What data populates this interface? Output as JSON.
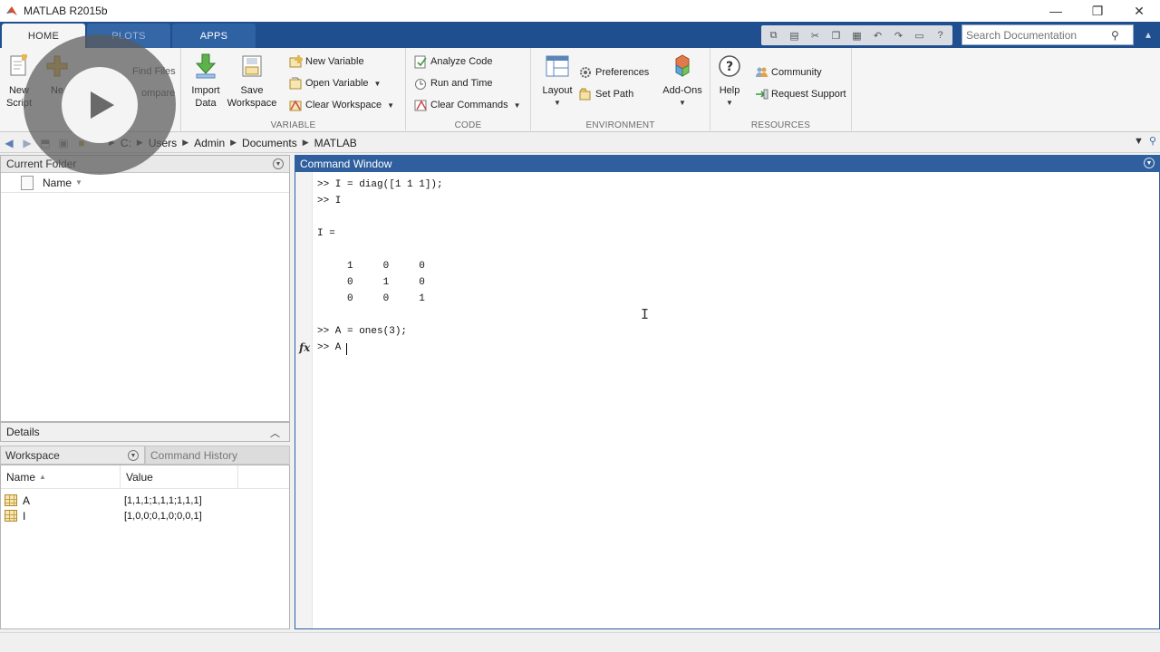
{
  "window": {
    "title": "MATLAB R2015b",
    "controls": {
      "minimize": "—",
      "restore": "❐",
      "close": "✕"
    }
  },
  "tabs": [
    {
      "label": "HOME"
    },
    {
      "label": "PLOTS"
    },
    {
      "label": "APPS"
    }
  ],
  "search": {
    "placeholder": "Search Documentation"
  },
  "ribbon": {
    "file": {
      "new_script_1": "New",
      "new_script_2": "Script",
      "new_1": "Ne",
      "find_files": "Find Files",
      "compare": "ompare"
    },
    "variable": {
      "label": "VARIABLE",
      "import_1": "Import",
      "import_2": "Data",
      "save_1": "Save",
      "save_2": "Workspace",
      "new_variable": "New Variable",
      "open_variable": "Open Variable",
      "clear_workspace": "Clear Workspace"
    },
    "code": {
      "label": "CODE",
      "analyze": "Analyze Code",
      "run_time": "Run and Time",
      "clear_commands": "Clear Commands"
    },
    "environment": {
      "label": "ENVIRONMENT",
      "layout": "Layout",
      "preferences": "Preferences",
      "set_path": "Set Path",
      "addons": "Add-Ons"
    },
    "resources": {
      "label": "RESOURCES",
      "help": "Help",
      "community": "Community",
      "request_support": "Request Support"
    }
  },
  "address": {
    "crumbs": [
      "C:",
      "Users",
      "Admin",
      "Documents",
      "MATLAB"
    ]
  },
  "current_folder": {
    "title": "Current Folder",
    "column_name": "Name"
  },
  "details": {
    "title": "Details"
  },
  "workspace": {
    "tab": "Workspace",
    "history_tab": "Command History",
    "columns": {
      "name": "Name",
      "value": "Value"
    },
    "rows": [
      {
        "name": "A",
        "value": "[1,1,1;1,1,1;1,1,1]"
      },
      {
        "name": "I",
        "value": "[1,0,0;0,1,0;0,0,1]"
      }
    ]
  },
  "command_window": {
    "title": "Command Window",
    "lines": [
      ">> I = diag([1 1 1]);",
      ">> I",
      "I =",
      "     1     0     0",
      "     0     1     0",
      "     0     0     1",
      ">> A = ones(3);",
      ">> A"
    ],
    "prompt_icon": "fx"
  }
}
